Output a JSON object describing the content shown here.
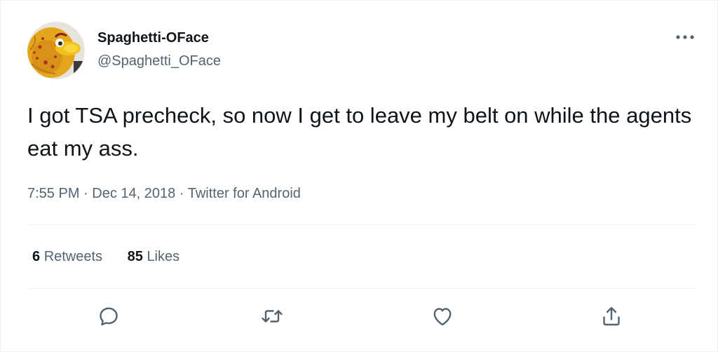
{
  "tweet": {
    "author_name": "Spaghetti-OFace",
    "author_handle": "@Spaghetti_OFace",
    "text": "I got TSA precheck, so now I get to leave my belt on while the agents eat my ass.",
    "time": "7:55 PM",
    "separator": "·",
    "date": "Dec 14, 2018",
    "source": "Twitter for Android"
  },
  "stats": {
    "retweets_count": "6",
    "retweets_label": "Retweets",
    "likes_count": "85",
    "likes_label": "Likes"
  },
  "icons": {
    "more": "more-horizontal-icon",
    "reply": "reply-icon",
    "retweet": "retweet-icon",
    "like": "heart-icon",
    "share": "share-icon"
  },
  "colors": {
    "text_primary": "#0f1419",
    "text_secondary": "#536471",
    "divider": "#eff3f4",
    "icon": "#536471"
  }
}
